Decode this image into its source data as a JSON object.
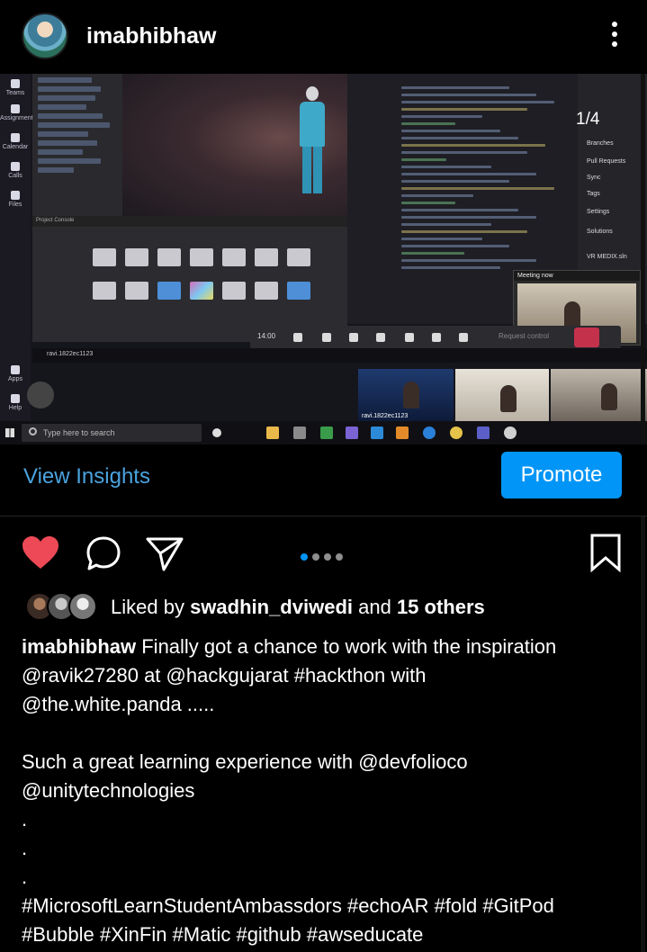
{
  "header": {
    "username": "imabhibhaw"
  },
  "photo": {
    "page_indicator": "1/4",
    "meeting_title": "Meeting now",
    "call_time": "14:00",
    "request_control": "Request control",
    "teams_rail": [
      "Teams",
      "Assignments",
      "Calendar",
      "Calls",
      "Files",
      "Apps",
      "Help"
    ],
    "search_placeholder": "Type here to search",
    "tile_label": "ravi.1822ec1123",
    "vs_items": [
      "Branches",
      "Pull Requests",
      "Sync",
      "Tags",
      "Settings",
      "Solutions",
      "VR MEDIX.sln"
    ],
    "project_tabs": "Project   Console"
  },
  "insights": {
    "view_insights": "View Insights",
    "promote": "Promote"
  },
  "carousel": {
    "count": 4,
    "active_index": 0
  },
  "likes": {
    "prefix": "Liked by ",
    "user": "swadhin_dviwedi",
    "middle": " and ",
    "others": "15 others"
  },
  "caption": {
    "username": "imabhibhaw",
    "line1_rest": " Finally got a chance to work with the inspiration",
    "line2": "@ravik27280 at @hackgujarat #hackthon with",
    "line3": "@the.white.panda .....",
    "line4": "Such a great learning experience with @devfolioco",
    "line5": "@unitytechnologies",
    "dot1": ".",
    "dot2": ".",
    "dot3": ".",
    "line6": "#MicrosoftLearnStudentAmbassdors #echoAR #fold #GitPod",
    "line7": "#Bubble #XinFin #Matic #github #awseducate"
  },
  "colors": {
    "accent_blue": "#0095f6",
    "link_blue": "#4aa3df",
    "heart_red": "#ed4956"
  }
}
